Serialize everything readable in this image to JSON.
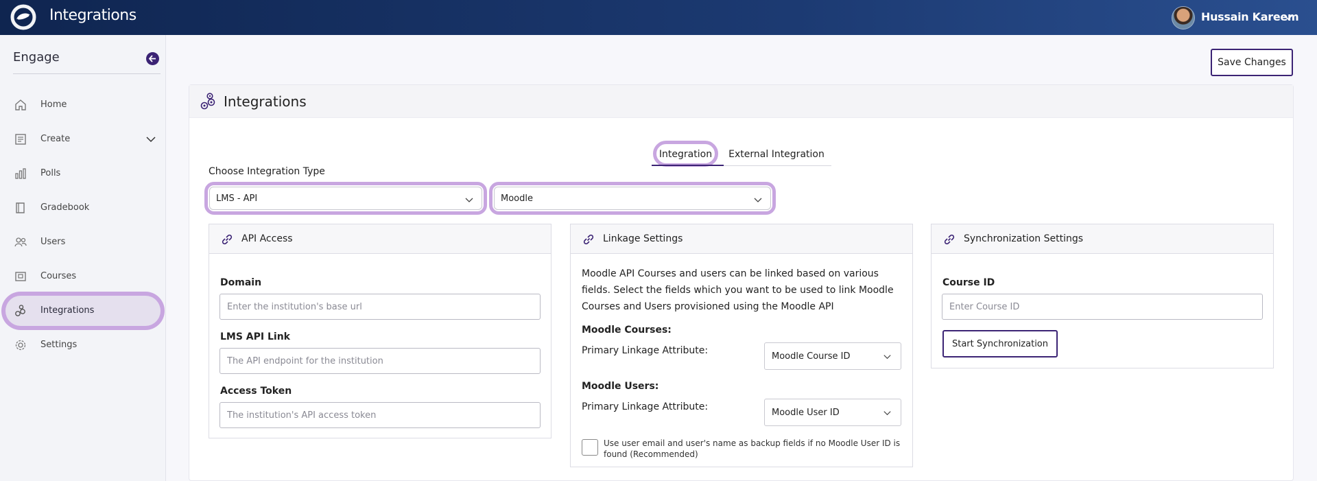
{
  "topbar": {
    "app_title": "Integrations",
    "user_name": "Hussain Kareem"
  },
  "sidebar": {
    "brand": "Engage",
    "items": [
      {
        "label": "Home",
        "icon": "home-icon"
      },
      {
        "label": "Create",
        "icon": "create-icon"
      },
      {
        "label": "Polls",
        "icon": "bar-chart-icon"
      },
      {
        "label": "Gradebook",
        "icon": "book-icon"
      },
      {
        "label": "Users",
        "icon": "users-icon"
      },
      {
        "label": "Courses",
        "icon": "courses-icon"
      },
      {
        "label": "Integrations",
        "icon": "integrations-icon",
        "active": true
      },
      {
        "label": "Settings",
        "icon": "gear-icon"
      }
    ]
  },
  "main": {
    "save_label": "Save Changes",
    "card_title": "Integrations",
    "tabs": [
      {
        "label": "Integration",
        "active": true
      },
      {
        "label": "External Integration",
        "active": false
      }
    ],
    "choose_label": "Choose Integration Type",
    "integration_type": "LMS - API",
    "provider": "Moodle"
  },
  "api_access": {
    "title": "API Access",
    "domain_label": "Domain",
    "domain_placeholder": "Enter the institution's base url",
    "link_label": "LMS API Link",
    "link_placeholder": "The API endpoint for the institution",
    "token_label": "Access Token",
    "token_placeholder": "The institution's API access token"
  },
  "linkage": {
    "title": "Linkage Settings",
    "description": "Moodle API Courses and users can be linked based on various fields. Select the fields which you want to be used to link Moodle Courses and Users provisioned using the Moodle API",
    "courses_heading": "Moodle Courses:",
    "courses_attr_label": "Primary Linkage Attribute:",
    "courses_attr_value": "Moodle Course ID",
    "users_heading": "Moodle Users:",
    "users_attr_label": "Primary Linkage Attribute:",
    "users_attr_value": "Moodle User ID",
    "backup_text": "Use user email and user's name as backup fields if no Moodle User ID is found (Recommended)",
    "backup_checked": false
  },
  "sync": {
    "title": "Synchronization Settings",
    "course_id_label": "Course ID",
    "course_id_placeholder": "Enter Course ID",
    "start_label": "Start Synchronization"
  },
  "colors": {
    "topbar_start": "#0f2550",
    "topbar_end": "#2a4f8f",
    "accent": "#3b2374",
    "highlight": "#c8a6e0"
  }
}
